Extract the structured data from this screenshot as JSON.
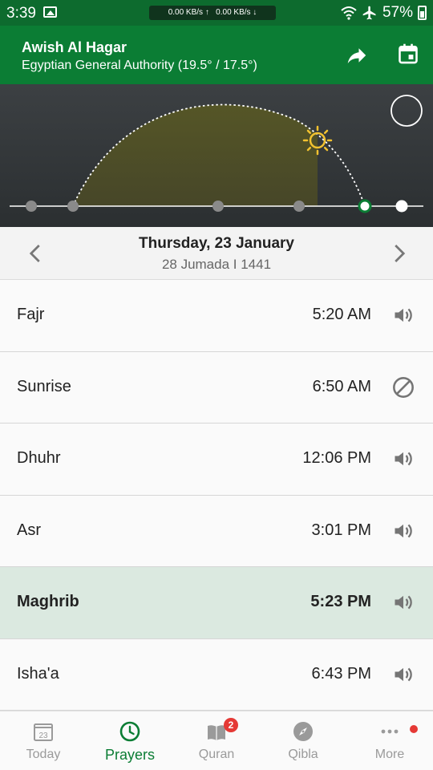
{
  "status_bar": {
    "time": "3:39",
    "net_up": "0.00 KB/s ↑",
    "net_down": "0.00 KB/s ↓",
    "battery": "57%"
  },
  "app_bar": {
    "title": "Awish Al Hagar",
    "subtitle": "Egyptian General Authority (19.5° / 17.5°)"
  },
  "date": {
    "gregorian": "Thursday, 23 January",
    "hijri": "28 Jumada I 1441"
  },
  "prayers": [
    {
      "name": "Fajr",
      "time": "5:20 AM",
      "alert": "speaker-icon"
    },
    {
      "name": "Sunrise",
      "time": "6:50 AM",
      "alert": "muted-icon"
    },
    {
      "name": "Dhuhr",
      "time": "12:06 PM",
      "alert": "speaker-icon"
    },
    {
      "name": "Asr",
      "time": "3:01 PM",
      "alert": "speaker-icon"
    },
    {
      "name": "Maghrib",
      "time": "5:23 PM",
      "alert": "speaker-icon",
      "active": true
    },
    {
      "name": "Isha'a",
      "time": "6:43 PM",
      "alert": "speaker-icon"
    }
  ],
  "bottom_nav": [
    {
      "label": "Today",
      "calendar_day": "23"
    },
    {
      "label": "Prayers",
      "active": true
    },
    {
      "label": "Quran",
      "badge": "2"
    },
    {
      "label": "Qibla"
    },
    {
      "label": "More",
      "dot": true
    }
  ],
  "colors": {
    "brand": "#0b7d34",
    "status_bar": "#0d6b2e",
    "active_row": "#dbe9e0",
    "sun": "#f2c230",
    "badge": "#e53935"
  }
}
